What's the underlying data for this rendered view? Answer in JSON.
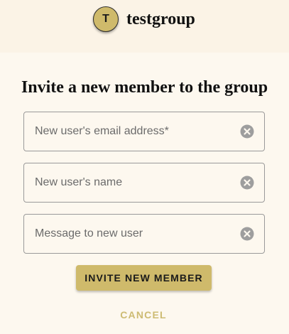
{
  "group": {
    "avatar_letter": "T",
    "name": "testgroup"
  },
  "dialog": {
    "title": "Invite a new member to the group"
  },
  "fields": {
    "email": {
      "value": "",
      "placeholder": "New user's email address*"
    },
    "name": {
      "value": "",
      "placeholder": "New user's name"
    },
    "message": {
      "value": "",
      "placeholder": "Message to new user"
    }
  },
  "icons": {
    "clear": "clear-icon"
  },
  "actions": {
    "invite_label": "INVITE NEW MEMBER",
    "cancel_label": "CANCEL"
  },
  "colors": {
    "accent": "#cfba6b",
    "cancel_text": "#cdbb73",
    "header_bg": "#fbf3e6",
    "page_bg": "#fdf8ef"
  }
}
